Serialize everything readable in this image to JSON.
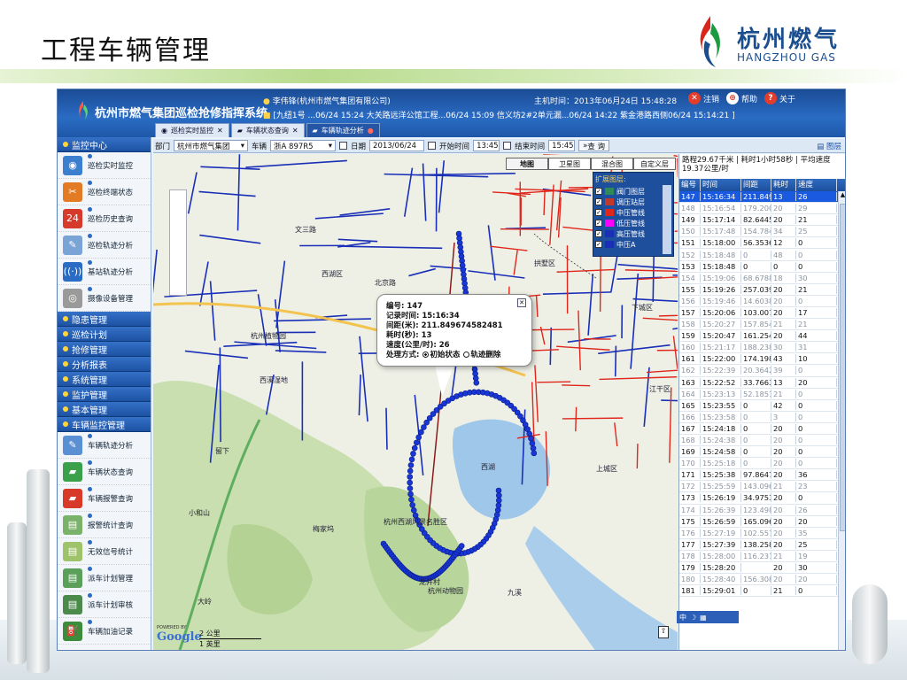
{
  "slide": {
    "title": "工程车辆管理",
    "logo_cn": "杭州燃气",
    "logo_en": "HANGZHOU GAS"
  },
  "app": {
    "title": "杭州市燃气集团巡检抢修指挥系统",
    "user": "李伟锋(杭州市燃气集团有限公司)",
    "host_time": "主机时间：2013年06月24日 15:48:28",
    "marquee": "[九纽1号 ...06/24 15:24 大关路远洋公馆工程...06/24 15:09 信义坊2#2单元漏...06/24 14:22 紫金港路西侧06/24 15:14:21 ]",
    "buttons": {
      "logout": "注销",
      "help": "帮助",
      "about": "关于"
    },
    "tabs": [
      "巡检实时监控",
      "车辆状态查询",
      "车辆轨迹分析"
    ]
  },
  "sidebar": {
    "head": "监控中心",
    "monitor_items": [
      "巡检实时监控",
      "巡检终端状态",
      "巡检历史查询",
      "巡检轨迹分析",
      "基站轨迹分析",
      "摄像设备管理"
    ],
    "sections": [
      "隐患管理",
      "巡检计划",
      "抢修管理",
      "分析报表",
      "系统管理",
      "监护管理",
      "基本管理",
      "车辆监控管理"
    ],
    "vehicle_items": [
      "车辆轨迹分析",
      "车辆状态查询",
      "车辆报警查询",
      "报警统计查询",
      "无效信号统计",
      "派车计划管理",
      "派车计划审核",
      "车辆加油记录"
    ]
  },
  "toolbar": {
    "dept_label": "部门",
    "dept_value": "杭州市燃气集团",
    "vehicle_label": "车辆",
    "vehicle_value": "浙A 897R5",
    "date_label": "日期",
    "date_value": "2013/06/24",
    "start_label": "开始时间",
    "start_value": "13:45",
    "end_label": "结束时间",
    "end_value": "15:45",
    "query": "查 询",
    "layers": "图层"
  },
  "map": {
    "types": [
      "地图",
      "卫星图",
      "混合图",
      "自定义层"
    ],
    "layer_title": "扩展图层:",
    "layers": [
      "阀门图层",
      "调压站层",
      "中压管线",
      "低压管线",
      "高压管线",
      "中压A"
    ],
    "popup": {
      "id": "编号: 147",
      "time": "记录时间: 15:16:34",
      "dist": "间距(米): 211.849674582481",
      "dur": "耗时(秒): 13",
      "speed": "速度(公里/时): 26",
      "mode_label": "处理方式:",
      "opt1": "初始状态",
      "opt2": "轨迹删除"
    },
    "labels": [
      {
        "t": "下城区"
      },
      {
        "t": "拱墅区"
      },
      {
        "t": "西湖区"
      },
      {
        "t": "上城区"
      },
      {
        "t": "江干区"
      },
      {
        "t": "杭州植物园"
      },
      {
        "t": "西湖"
      },
      {
        "t": "杭州西湖风景名胜区"
      },
      {
        "t": "龙井村"
      },
      {
        "t": "梅家坞"
      },
      {
        "t": "九溪"
      },
      {
        "t": "西溪湿地"
      },
      {
        "t": "杭州动物园"
      },
      {
        "t": "文三路"
      },
      {
        "t": "留下"
      },
      {
        "t": "小和山"
      },
      {
        "t": "大岭"
      },
      {
        "t": "北京路"
      }
    ],
    "scale_top": "2 公里",
    "scale_bottom": "1 英里",
    "google": "Google",
    "powered": "POWERED BY"
  },
  "panel": {
    "summary": "路程29.67千米 | 耗时1小时58秒 | 平均速度19.37公里/时",
    "headers": [
      "编号",
      "时间",
      "间距",
      "耗时",
      "速度"
    ],
    "rows": [
      [
        "147",
        "15:16:34",
        "211.849(",
        "13",
        "26"
      ],
      [
        "148",
        "15:16:54",
        "179.200(",
        "20",
        "29"
      ],
      [
        "149",
        "15:17:14",
        "82.6445(",
        "20",
        "21"
      ],
      [
        "150",
        "15:17:48",
        "154.784(",
        "34",
        "25"
      ],
      [
        "151",
        "15:18:00",
        "56.3536(",
        "12",
        "0"
      ],
      [
        "152",
        "15:18:48",
        "0",
        "48",
        "0"
      ],
      [
        "153",
        "15:18:48",
        "0",
        "0",
        "0"
      ],
      [
        "154",
        "15:19:06",
        "68.6788(",
        "18",
        "30"
      ],
      [
        "155",
        "15:19:26",
        "257.039(",
        "20",
        "21"
      ],
      [
        "156",
        "15:19:46",
        "14.6038(",
        "20",
        "0"
      ],
      [
        "157",
        "15:20:06",
        "103.007(",
        "20",
        "17"
      ],
      [
        "158",
        "15:20:27",
        "157.854(",
        "21",
        "21"
      ],
      [
        "159",
        "15:20:47",
        "161.254(",
        "20",
        "44"
      ],
      [
        "160",
        "15:21:17",
        "188.238(",
        "30",
        "31"
      ],
      [
        "161",
        "15:22:00",
        "174.198(",
        "43",
        "10"
      ],
      [
        "162",
        "15:22:39",
        "20.3642(",
        "39",
        "0"
      ],
      [
        "163",
        "15:22:52",
        "33.7663(",
        "13",
        "20"
      ],
      [
        "164",
        "15:23:13",
        "52.1851(",
        "21",
        "0"
      ],
      [
        "165",
        "15:23:55",
        "0",
        "42",
        "0"
      ],
      [
        "166",
        "15:23:58",
        "0",
        "3",
        "0"
      ],
      [
        "167",
        "15:24:18",
        "0",
        "20",
        "0"
      ],
      [
        "168",
        "15:24:38",
        "0",
        "20",
        "0"
      ],
      [
        "169",
        "15:24:58",
        "0",
        "20",
        "0"
      ],
      [
        "170",
        "15:25:18",
        "0",
        "20",
        "0"
      ],
      [
        "171",
        "15:25:38",
        "97.8647(",
        "20",
        "36"
      ],
      [
        "172",
        "15:25:59",
        "143.096(",
        "21",
        "23"
      ],
      [
        "173",
        "15:26:19",
        "34.9753(",
        "20",
        "0"
      ],
      [
        "174",
        "15:26:39",
        "123.498(",
        "20",
        "26"
      ],
      [
        "175",
        "15:26:59",
        "165.096(",
        "20",
        "20"
      ],
      [
        "176",
        "15:27:19",
        "102.557(",
        "20",
        "35"
      ],
      [
        "177",
        "15:27:39",
        "138.258(",
        "20",
        "25"
      ],
      [
        "178",
        "15:28:00",
        "116.231(",
        "21",
        "19"
      ],
      [
        "179",
        "15:28:20",
        "",
        "20",
        "30"
      ],
      [
        "180",
        "15:28:40",
        "156.308(",
        "20",
        "20"
      ],
      [
        "181",
        "15:29:01",
        "0",
        "21",
        "0"
      ]
    ]
  },
  "colors": {
    "accent": "#1d52a3",
    "selected": "#1a5ae0",
    "pipe_red": "#e0261b",
    "pipe_blue": "#1a2fb8",
    "track": "#1837d4"
  }
}
